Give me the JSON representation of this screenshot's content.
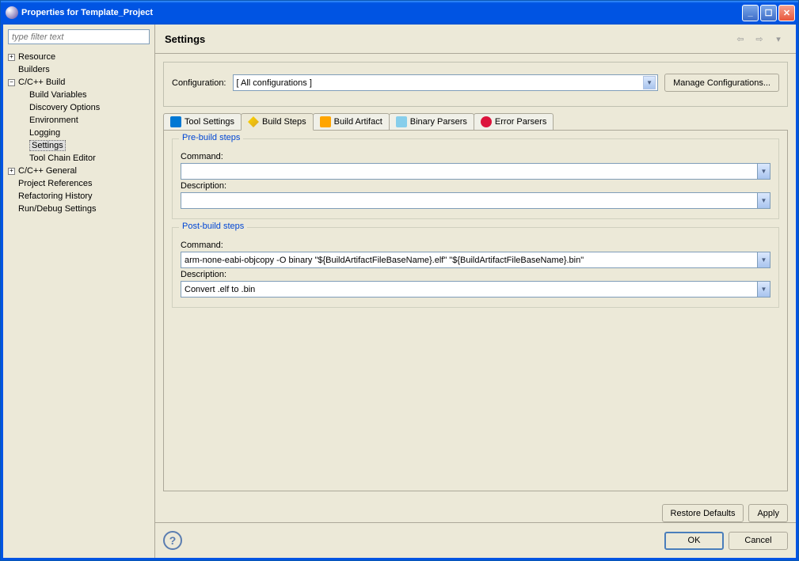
{
  "window": {
    "title": "Properties for Template_Project"
  },
  "sidebar": {
    "filter_placeholder": "type filter text",
    "items": [
      {
        "label": "Resource",
        "toggle": "+",
        "indent": 0
      },
      {
        "label": "Builders",
        "toggle": "",
        "indent": 0
      },
      {
        "label": "C/C++ Build",
        "toggle": "-",
        "indent": 0
      },
      {
        "label": "Build Variables",
        "toggle": "",
        "indent": 1
      },
      {
        "label": "Discovery Options",
        "toggle": "",
        "indent": 1
      },
      {
        "label": "Environment",
        "toggle": "",
        "indent": 1
      },
      {
        "label": "Logging",
        "toggle": "",
        "indent": 1
      },
      {
        "label": "Settings",
        "toggle": "",
        "indent": 1,
        "selected": true
      },
      {
        "label": "Tool Chain Editor",
        "toggle": "",
        "indent": 1
      },
      {
        "label": "C/C++ General",
        "toggle": "+",
        "indent": 0
      },
      {
        "label": "Project References",
        "toggle": "",
        "indent": 0
      },
      {
        "label": "Refactoring History",
        "toggle": "",
        "indent": 0
      },
      {
        "label": "Run/Debug Settings",
        "toggle": "",
        "indent": 0
      }
    ]
  },
  "header": {
    "title": "Settings"
  },
  "config": {
    "label": "Configuration:",
    "value": "[ All configurations ]",
    "manage_btn": "Manage Configurations..."
  },
  "tabs": [
    {
      "label": "Tool Settings",
      "icon": "ti-tool"
    },
    {
      "label": "Build Steps",
      "icon": "ti-steps",
      "active": true
    },
    {
      "label": "Build Artifact",
      "icon": "ti-artifact"
    },
    {
      "label": "Binary Parsers",
      "icon": "ti-binary"
    },
    {
      "label": "Error Parsers",
      "icon": "ti-error"
    }
  ],
  "prebuild": {
    "legend": "Pre-build steps",
    "command_label": "Command:",
    "command_value": "",
    "description_label": "Description:",
    "description_value": ""
  },
  "postbuild": {
    "legend": "Post-build steps",
    "command_label": "Command:",
    "command_value": "arm-none-eabi-objcopy -O binary \"${BuildArtifactFileBaseName}.elf\" \"${BuildArtifactFileBaseName}.bin\"",
    "description_label": "Description:",
    "description_value": "Convert .elf to .bin"
  },
  "buttons": {
    "restore_defaults": "Restore Defaults",
    "apply": "Apply",
    "ok": "OK",
    "cancel": "Cancel"
  }
}
